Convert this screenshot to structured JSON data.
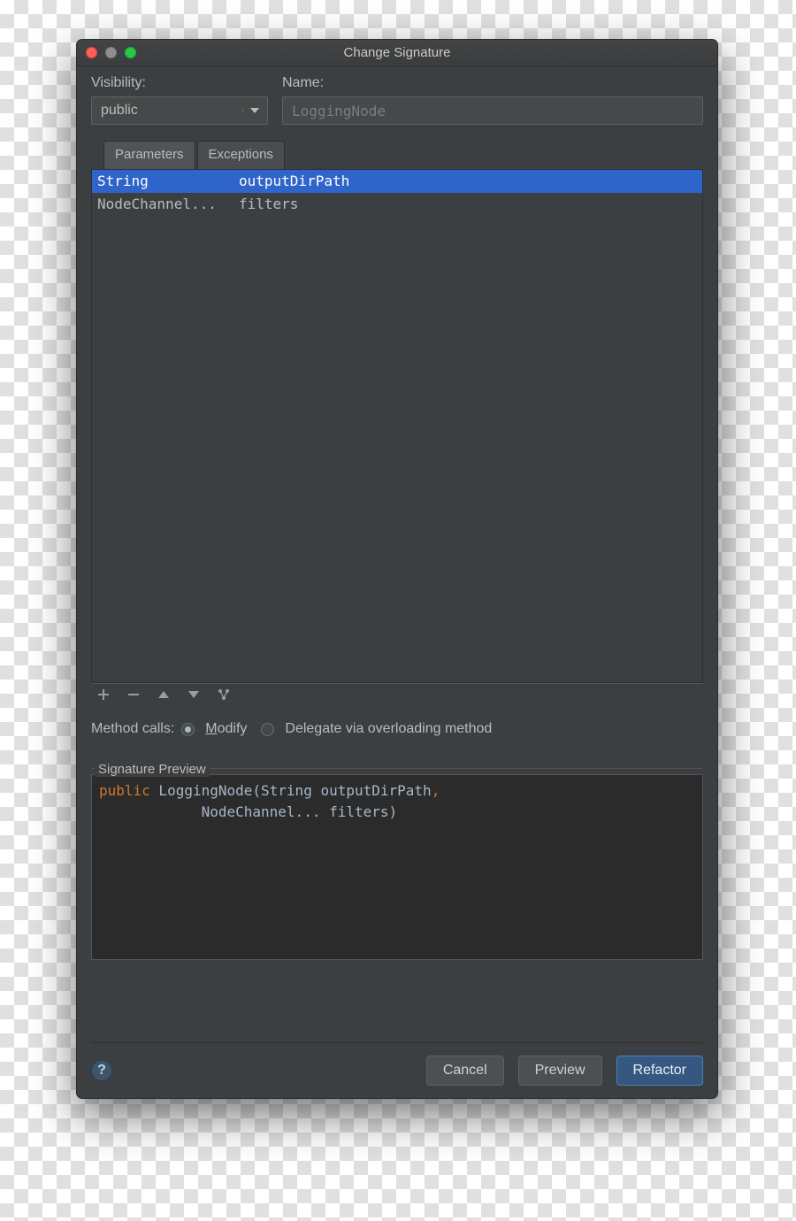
{
  "window": {
    "title": "Change Signature"
  },
  "labels": {
    "visibility": "Visibility:",
    "name": "Name:",
    "methodCalls": "Method calls:",
    "signaturePreview": "Signature Preview"
  },
  "visibility": {
    "value": "public"
  },
  "name": {
    "value": "LoggingNode"
  },
  "tabs": [
    {
      "label": "Parameters",
      "active": true
    },
    {
      "label": "Exceptions",
      "active": false
    }
  ],
  "parameters": [
    {
      "type": "String",
      "name": "outputDirPath",
      "selected": true
    },
    {
      "type": "NodeChannel...",
      "name": "filters",
      "selected": false
    }
  ],
  "methodCalls": {
    "options": [
      {
        "label": "Modify",
        "checked": true
      },
      {
        "label": "Delegate via overloading method",
        "checked": false
      }
    ]
  },
  "signaturePreview": {
    "keyword": "public",
    "line1_rest": " LoggingNode(String outputDirPath",
    "line2": "            NodeChannel... filters)"
  },
  "buttons": {
    "cancel": "Cancel",
    "preview": "Preview",
    "refactor": "Refactor"
  },
  "helpGlyph": "?"
}
